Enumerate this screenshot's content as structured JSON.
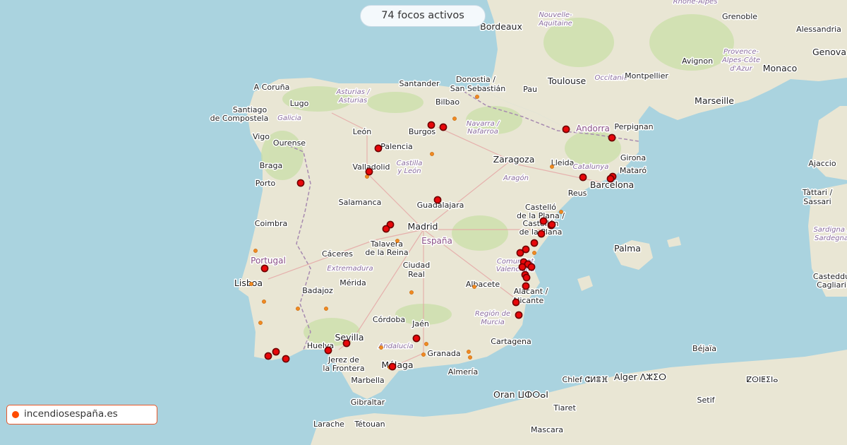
{
  "counter_text": "74 focos activos",
  "brand": {
    "label": "incendiosespaña.es",
    "color": "#ff4b00"
  },
  "colors": {
    "sea": "#aad3df",
    "land": "#e9e6d4",
    "fire_major": "#e8070a",
    "fire_minor": "#f08a22"
  },
  "labels": {
    "acoruna": "A Coruña",
    "lugo": "Lugo",
    "santiago1": "Santiago",
    "santiago2": "de Compostela",
    "galicia": "Galicia",
    "ourense": "Ourense",
    "vigo": "Vigo",
    "asturias1": "Asturias /",
    "asturias2": "Asturias",
    "santander": "Santander",
    "donostia1": "Donostia /",
    "donostia2": "San Sebastián",
    "bilbao": "Bilbao",
    "leon": "León",
    "burgos": "Burgos",
    "navarra1": "Navarra /",
    "navarra2": "Nafarroa",
    "palencia": "Palencia",
    "braga": "Braga",
    "porto": "Porto",
    "valladolid": "Valladolid",
    "castilla1": "Castilla",
    "castilla2": "y León",
    "salamanca": "Salamanca",
    "guadalajara": "Guadalajara",
    "madrid": "Madrid",
    "espana": "España",
    "talavera1": "Talavera",
    "talavera2": "de la Reina",
    "coimbra": "Coimbra",
    "portugal": "Portugal",
    "caceres": "Cáceres",
    "extremadura": "Extremadura",
    "ciudadreal1": "Ciudad",
    "ciudadreal2": "Real",
    "lisboa": "Lisboa",
    "badajoz": "Badajoz",
    "merida": "Mérida",
    "albacete": "Albacete",
    "zaragoza": "Zaragoza",
    "aragon": "Aragón",
    "lleida": "Lleida",
    "catalunya": "Catalunya",
    "andorra": "Andorra",
    "reus": "Reus",
    "barcelona": "Barcelona",
    "mataro": "Mataró",
    "girona": "Girona",
    "perpignan": "Perpignan",
    "castello1": "Castelló",
    "castello2": "de la Plana /",
    "castello3": "Castellón",
    "castello4": "de la Plana",
    "comunitat1": "Comunitat",
    "comunitat2": "Valenciana",
    "alacant1": "Alacant /",
    "alacant2": "Alicante",
    "cordoba": "Córdoba",
    "jaen": "Jaén",
    "murcia1": "Región de",
    "murcia2": "Murcia",
    "cartagena": "Cartagena",
    "huelva": "Huelva",
    "sevilla": "Sevilla",
    "andalucia": "Andalucía",
    "granada": "Granada",
    "jerez1": "Jerez de",
    "jerez2": "la Frontera",
    "malaga": "Málaga",
    "almeria": "Almería",
    "marbella": "Marbella",
    "gibraltar": "Gibraltar",
    "larache": "Larache",
    "tetouan": "Tétouan",
    "bordeaux": "Bordeaux",
    "nouvelle1": "Nouvelle-",
    "nouvelle2": "Aquitaine",
    "toulouse": "Toulouse",
    "occitanie": "Occitanie",
    "pau": "Pau",
    "montpellier": "Montpellier",
    "marseille": "Marseille",
    "avignon": "Avignon",
    "provence1": "Provence-",
    "provence2": "Alpes-Côte",
    "provence3": "d'Azur",
    "monaco": "Monaco",
    "genova": "Genova",
    "grenoble": "Grenoble",
    "alessandria": "Alessandria",
    "rhone": "Rhône-Alpes",
    "palma": "Palma",
    "ajaccio": "Ajaccio",
    "sassari1": "Tàttari /",
    "sassari2": "Sassari",
    "sardegna1": "Sardigna /",
    "sardegna2": "Sardegna",
    "cagliari1": "Casteddu",
    "cagliari2": "Cagliari",
    "oran": "Oran ⵡⵀⵔⴰⵏ",
    "chlef": "Chlef ⵛⵍⴻⴼ",
    "alger": "Alger ⴷⵣⵉⵔ",
    "tiaret": "Tiaret",
    "setif": "Setif",
    "bejaia": "Béjaïa",
    "constantine": "ⵇⵙⵏⵟⵉⵏⴰ",
    "mascara": "Mascara"
  },
  "map_legend": {
    "fires_shown": 37
  }
}
